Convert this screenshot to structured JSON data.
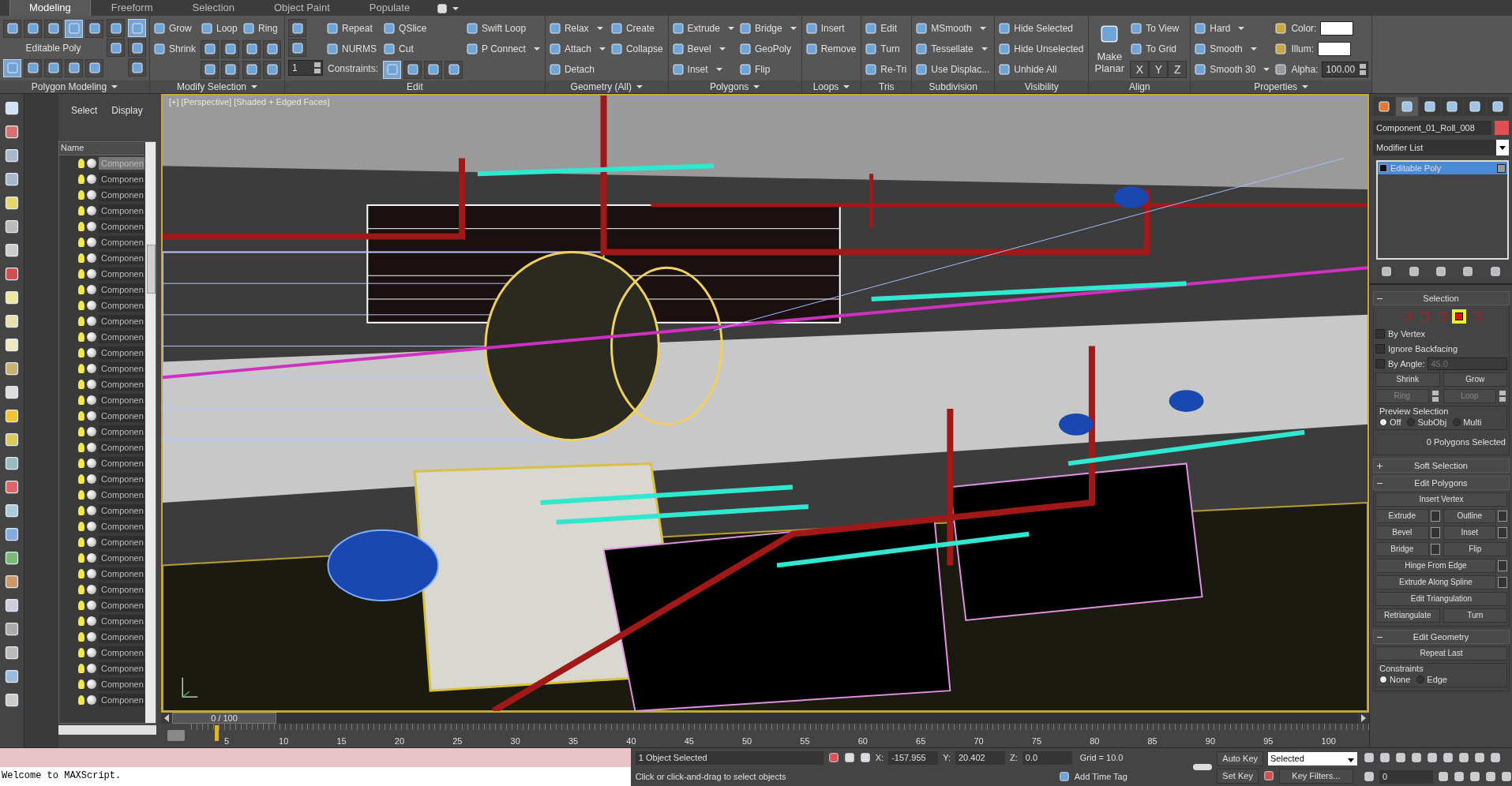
{
  "ribbon": {
    "tabs": [
      {
        "label": "Modeling",
        "selected": true
      },
      {
        "label": "Freeform",
        "selected": false
      },
      {
        "label": "Selection",
        "selected": false
      },
      {
        "label": "Object Paint",
        "selected": false
      },
      {
        "label": "Populate",
        "selected": false
      }
    ],
    "panels": [
      {
        "title": "Polygon Modeling",
        "menu": true,
        "columns": [
          [
            {
              "kind": "row",
              "items": [
                {
                  "kind": "icon",
                  "selected": false
                },
                {
                  "kind": "icon",
                  "selected": false
                },
                {
                  "kind": "icon",
                  "selected": false
                },
                {
                  "kind": "icon",
                  "selected": true
                },
                {
                  "kind": "icon",
                  "selected": false
                }
              ]
            },
            {
              "kind": "text",
              "label": "Editable Poly"
            },
            {
              "kind": "row",
              "items": [
                {
                  "kind": "icon",
                  "selected": true
                },
                {
                  "kind": "icon",
                  "selected": false
                },
                {
                  "kind": "icon",
                  "selected": false
                },
                {
                  "kind": "icon",
                  "selected": false
                },
                {
                  "kind": "icon",
                  "selected": false
                }
              ]
            }
          ],
          [
            {
              "kind": "icon",
              "selected": false
            },
            {
              "kind": "icon",
              "selected": false
            }
          ],
          [
            {
              "kind": "icon",
              "selected": true
            },
            {
              "kind": "icon",
              "selected": false
            },
            {
              "kind": "icon",
              "selected": false
            }
          ]
        ]
      },
      {
        "title": "Modify Selection",
        "menu": true,
        "columns": [
          [
            {
              "kind": "button",
              "label": "Grow"
            },
            {
              "kind": "button",
              "label": "Shrink"
            }
          ],
          [
            {
              "kind": "button",
              "label": "Loop"
            },
            {
              "kind": "row",
              "items": [
                {
                  "kind": "icon",
                  "selected": false
                },
                {
                  "kind": "icon",
                  "selected": false
                }
              ]
            },
            {
              "kind": "row",
              "items": [
                {
                  "kind": "icon",
                  "selected": false
                },
                {
                  "kind": "icon",
                  "selected": false
                }
              ]
            }
          ],
          [
            {
              "kind": "button",
              "label": "Ring"
            },
            {
              "kind": "row",
              "items": [
                {
                  "kind": "icon",
                  "selected": false
                },
                {
                  "kind": "icon",
                  "selected": false
                }
              ]
            },
            {
              "kind": "row",
              "items": [
                {
                  "kind": "icon",
                  "selected": false
                },
                {
                  "kind": "icon",
                  "selected": false
                }
              ]
            }
          ]
        ]
      },
      {
        "title": "Edit",
        "menu": false,
        "columns": [
          [
            {
              "kind": "icon",
              "selected": false
            },
            {
              "kind": "icon",
              "selected": false
            },
            {
              "kind": "spinner",
              "value": "1"
            }
          ],
          [
            {
              "kind": "button",
              "label": "Repeat"
            },
            {
              "kind": "button",
              "label": "NURMS"
            },
            {
              "kind": "text",
              "label": "Constraints:"
            }
          ],
          [
            {
              "kind": "button",
              "label": "QSlice"
            },
            {
              "kind": "button",
              "label": "Cut"
            },
            {
              "kind": "row",
              "items": [
                {
                  "kind": "icon",
                  "selected": true
                },
                {
                  "kind": "icon",
                  "selected": false
                },
                {
                  "kind": "icon",
                  "selected": false
                },
                {
                  "kind": "icon",
                  "selected": false
                }
              ]
            }
          ],
          [
            {
              "kind": "button",
              "label": "Swift Loop"
            },
            {
              "kind": "dropdown",
              "label": "P Connect"
            }
          ]
        ]
      },
      {
        "title": "Geometry (All)",
        "menu": true,
        "columns": [
          [
            {
              "kind": "dropdown",
              "label": "Relax"
            },
            {
              "kind": "dropdown",
              "label": "Attach"
            },
            {
              "kind": "button",
              "label": "Detach"
            }
          ],
          [
            {
              "kind": "button",
              "label": "Create"
            },
            {
              "kind": "button",
              "label": "Collapse"
            }
          ]
        ]
      },
      {
        "title": "Polygons",
        "menu": true,
        "columns": [
          [
            {
              "kind": "dropdown",
              "label": "Extrude"
            },
            {
              "kind": "dropdown",
              "label": "Bevel"
            },
            {
              "kind": "dropdown",
              "label": "Inset"
            }
          ],
          [
            {
              "kind": "dropdown",
              "label": "Bridge"
            },
            {
              "kind": "button",
              "label": "GeoPoly"
            },
            {
              "kind": "button",
              "label": "Flip"
            }
          ]
        ]
      },
      {
        "title": "Loops",
        "menu": true,
        "columns": [
          [
            {
              "kind": "button",
              "label": "Insert"
            },
            {
              "kind": "button",
              "label": "Remove"
            }
          ]
        ]
      },
      {
        "title": "Tris",
        "menu": false,
        "columns": [
          [
            {
              "kind": "button",
              "label": "Edit"
            },
            {
              "kind": "button",
              "label": "Turn"
            },
            {
              "kind": "button",
              "label": "Re-Tri"
            }
          ]
        ]
      },
      {
        "title": "Subdivision",
        "menu": false,
        "columns": [
          [
            {
              "kind": "dropdown",
              "label": "MSmooth"
            },
            {
              "kind": "dropdown",
              "label": "Tessellate"
            },
            {
              "kind": "button",
              "label": "Use Displac..."
            }
          ]
        ]
      },
      {
        "title": "Visibility",
        "menu": false,
        "columns": [
          [
            {
              "kind": "button",
              "label": "Hide Selected"
            },
            {
              "kind": "button",
              "label": "Hide Unselected"
            },
            {
              "kind": "button",
              "label": "Unhide All"
            }
          ]
        ]
      },
      {
        "title": "Align",
        "menu": false,
        "columns": [
          [
            {
              "kind": "big",
              "label": "Make Planar"
            }
          ],
          [
            {
              "kind": "button",
              "label": "To View"
            },
            {
              "kind": "button",
              "label": "To Grid"
            },
            {
              "kind": "keys",
              "keys": [
                "X",
                "Y",
                "Z"
              ]
            }
          ]
        ]
      },
      {
        "title": "Properties",
        "menu": true,
        "columns": [
          [
            {
              "kind": "dropdown",
              "label": "Hard"
            },
            {
              "kind": "dropdown",
              "label": "Smooth"
            },
            {
              "kind": "dropdown",
              "label": "Smooth 30"
            }
          ],
          [
            {
              "kind": "swatch",
              "label": "Color:"
            },
            {
              "kind": "swatch",
              "label": "Illum:"
            },
            {
              "kind": "spinner",
              "label": "Alpha:",
              "value": "100.00"
            }
          ]
        ]
      }
    ]
  },
  "scene_explorer": {
    "tabs": [
      "Select",
      "Display"
    ],
    "column": "Name",
    "rows": [
      {
        "name": "Componen",
        "selected": true
      },
      {
        "name": "Componen",
        "selected": false
      },
      {
        "name": "Componen",
        "selected": false
      },
      {
        "name": "Componen",
        "selected": false
      },
      {
        "name": "Componen",
        "selected": false
      },
      {
        "name": "Componen",
        "selected": false
      },
      {
        "name": "Componen",
        "selected": false
      },
      {
        "name": "Componen",
        "selected": false
      },
      {
        "name": "Componen",
        "selected": false
      },
      {
        "name": "Componen",
        "selected": false
      },
      {
        "name": "Componen",
        "selected": false
      },
      {
        "name": "Componen",
        "selected": false
      },
      {
        "name": "Componen",
        "selected": false
      },
      {
        "name": "Componen",
        "selected": false
      },
      {
        "name": "Componen",
        "selected": false
      },
      {
        "name": "Componen",
        "selected": false
      },
      {
        "name": "Componen",
        "selected": false
      },
      {
        "name": "Componen",
        "selected": false
      },
      {
        "name": "Componen",
        "selected": false
      },
      {
        "name": "Componen",
        "selected": false
      },
      {
        "name": "Componen",
        "selected": false
      },
      {
        "name": "Componen",
        "selected": false
      },
      {
        "name": "Componen",
        "selected": false
      },
      {
        "name": "Componen",
        "selected": false
      },
      {
        "name": "Componen",
        "selected": false
      },
      {
        "name": "Componen",
        "selected": false
      },
      {
        "name": "Componen",
        "selected": false
      },
      {
        "name": "Componen",
        "selected": false
      },
      {
        "name": "Componen",
        "selected": false
      },
      {
        "name": "Componen",
        "selected": false
      },
      {
        "name": "Componen",
        "selected": false
      },
      {
        "name": "Componen",
        "selected": false
      },
      {
        "name": "Componen",
        "selected": false
      },
      {
        "name": "Componen",
        "selected": false
      },
      {
        "name": "Componen",
        "selected": false
      }
    ]
  },
  "viewport": {
    "label": "[+] [Perspective] [Shaded + Edged Faces]"
  },
  "timeline": {
    "slider": "0 / 100",
    "level": 0,
    "ticks": [
      "5",
      "10",
      "15",
      "20",
      "25",
      "30",
      "35",
      "40",
      "45",
      "50",
      "55",
      "60",
      "65",
      "70",
      "75",
      "80",
      "85",
      "90",
      "95",
      "100"
    ]
  },
  "command_panel": {
    "tabs": [
      {
        "selected": false
      },
      {
        "selected": true
      },
      {
        "selected": false
      },
      {
        "selected": false
      },
      {
        "selected": false
      },
      {
        "selected": false
      }
    ],
    "object_name": "Component_01_Roll_008",
    "modifier_list": "Modifier List",
    "stack": [
      {
        "label": "Editable Poly",
        "selected": true
      }
    ],
    "rollouts": [
      {
        "title": "Selection",
        "expanded": true,
        "items": [
          {
            "kind": "subobjects",
            "levels": [
              {
                "selected": false
              },
              {
                "selected": false
              },
              {
                "selected": false
              },
              {
                "selected": true
              },
              {
                "selected": false
              }
            ]
          },
          {
            "kind": "checkbox",
            "label": "By Vertex",
            "checked": false
          },
          {
            "kind": "checkbox",
            "label": "Ignore Backfacing",
            "checked": false
          },
          {
            "kind": "angle",
            "label": "By Angle:",
            "checked": false,
            "value": "45.0"
          },
          {
            "kind": "buttons",
            "buttons": [
              {
                "label": "Shrink",
                "settings": false,
                "spinner": false,
                "disabled": false
              },
              {
                "label": "Grow",
                "settings": false,
                "spinner": false,
                "disabled": false
              }
            ]
          },
          {
            "kind": "buttons",
            "buttons": [
              {
                "label": "Ring",
                "settings": false,
                "spinner": true,
                "disabled": true
              },
              {
                "label": "Loop",
                "settings": false,
                "spinner": true,
                "disabled": true
              }
            ]
          },
          {
            "kind": "group",
            "title": "Preview Selection",
            "options": [
              {
                "label": "Off",
                "selected": true
              },
              {
                "label": "SubObj",
                "selected": false
              },
              {
                "label": "Multi",
                "selected": false
              }
            ]
          },
          {
            "kind": "note",
            "label": "0 Polygons Selected"
          }
        ]
      },
      {
        "title": "Soft Selection",
        "expanded": false
      },
      {
        "title": "Edit Polygons",
        "expanded": true,
        "items": [
          {
            "kind": "buttons",
            "buttons": [
              {
                "label": "Insert Vertex",
                "settings": false,
                "spinner": false,
                "disabled": false
              }
            ]
          },
          {
            "kind": "buttons",
            "buttons": [
              {
                "label": "Extrude",
                "settings": true,
                "spinner": false,
                "disabled": false
              },
              {
                "label": "Outline",
                "settings": true,
                "spinner": false,
                "disabled": false
              }
            ]
          },
          {
            "kind": "buttons",
            "buttons": [
              {
                "label": "Bevel",
                "settings": true,
                "spinner": false,
                "disabled": false
              },
              {
                "label": "Inset",
                "settings": true,
                "spinner": false,
                "disabled": false
              }
            ]
          },
          {
            "kind": "buttons",
            "buttons": [
              {
                "label": "Bridge",
                "settings": true,
                "spinner": false,
                "disabled": false
              },
              {
                "label": "Flip",
                "settings": false,
                "spinner": false,
                "disabled": false
              }
            ]
          },
          {
            "kind": "buttons",
            "buttons": [
              {
                "label": "Hinge From Edge",
                "settings": true,
                "spinner": false,
                "disabled": false
              }
            ]
          },
          {
            "kind": "buttons",
            "buttons": [
              {
                "label": "Extrude Along Spline",
                "settings": true,
                "spinner": false,
                "disabled": false
              }
            ]
          },
          {
            "kind": "buttons",
            "buttons": [
              {
                "label": "Edit Triangulation",
                "settings": false,
                "spinner": false,
                "disabled": false
              }
            ]
          },
          {
            "kind": "buttons",
            "buttons": [
              {
                "label": "Retriangulate",
                "settings": false,
                "spinner": false,
                "disabled": false
              },
              {
                "label": "Turn",
                "settings": false,
                "spinner": false,
                "disabled": false
              }
            ]
          }
        ]
      },
      {
        "title": "Edit Geometry",
        "expanded": true,
        "items": [
          {
            "kind": "buttons",
            "buttons": [
              {
                "label": "Repeat Last",
                "settings": false,
                "spinner": false,
                "disabled": false
              }
            ]
          },
          {
            "kind": "group",
            "title": "Constraints",
            "options": [
              {
                "label": "None",
                "selected": true
              },
              {
                "label": "Edge",
                "selected": false
              }
            ]
          }
        ]
      }
    ]
  },
  "listener": {
    "output": "Welcome to MAXScript."
  },
  "status_bar": {
    "selection": "1 Object Selected",
    "prompt": "Click or click-and-drag to select objects",
    "coords": [
      {
        "label": "X:",
        "value": "-157.955"
      },
      {
        "label": "Y:",
        "value": "20.402"
      },
      {
        "label": "Z:",
        "value": "0.0"
      }
    ],
    "grid": "Grid = 10.0",
    "add_time_tag": "Add Time Tag",
    "auto_key": "Auto Key",
    "set_key": "Set Key",
    "key_mode": "Selected",
    "key_filters": "Key Filters...",
    "frame": "0"
  }
}
